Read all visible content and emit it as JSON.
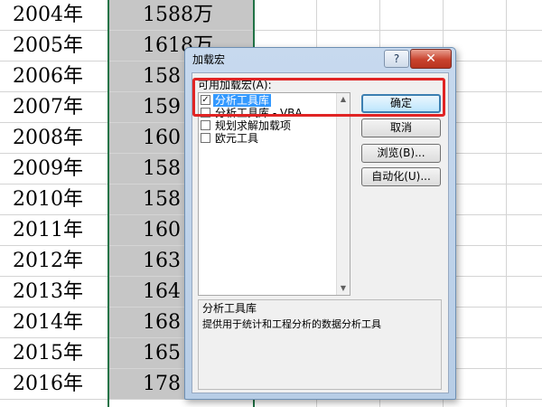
{
  "spreadsheet": {
    "rows": [
      {
        "year": "2004年",
        "value": "1588万"
      },
      {
        "year": "2005年",
        "value": "1618万"
      },
      {
        "year": "2006年",
        "value": "158"
      },
      {
        "year": "2007年",
        "value": "159"
      },
      {
        "year": "2008年",
        "value": "160"
      },
      {
        "year": "2009年",
        "value": "158"
      },
      {
        "year": "2010年",
        "value": "158"
      },
      {
        "year": "2011年",
        "value": "160"
      },
      {
        "year": "2012年",
        "value": "163"
      },
      {
        "year": "2013年",
        "value": "164"
      },
      {
        "year": "2014年",
        "value": "168"
      },
      {
        "year": "2015年",
        "value": "165"
      },
      {
        "year": "2016年",
        "value": "178"
      }
    ]
  },
  "dialog": {
    "title": "加载宏",
    "help_label": "?",
    "close_label": "✕",
    "list_label": "可用加载宏(A):",
    "items": [
      {
        "label": "分析工具库",
        "checked": true,
        "selected": true
      },
      {
        "label": "分析工具库 - VBA",
        "checked": false,
        "selected": false
      },
      {
        "label": "规划求解加载项",
        "checked": false,
        "selected": false
      },
      {
        "label": "欧元工具",
        "checked": false,
        "selected": false
      }
    ],
    "buttons": {
      "ok": "确定",
      "cancel": "取消",
      "browse": "浏览(B)...",
      "automation": "自动化(U)..."
    },
    "description": {
      "title": "分析工具库",
      "text": "提供用于统计和工程分析的数据分析工具"
    }
  },
  "colors": {
    "highlight": "#e02424",
    "selection": "#3399ff",
    "sheet_selection_border": "#217346"
  }
}
